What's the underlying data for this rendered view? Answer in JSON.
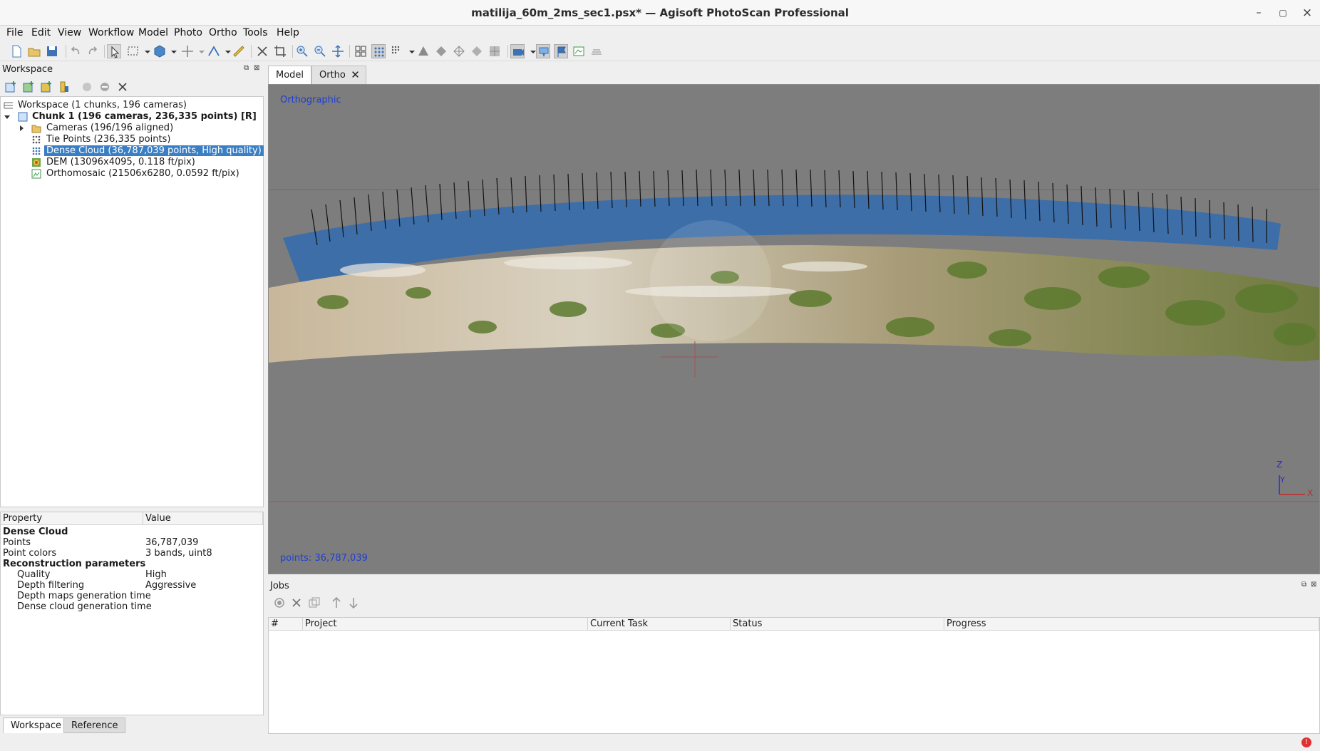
{
  "window": {
    "title": "matilija_60m_2ms_sec1.psx* — Agisoft PhotoScan Professional",
    "minimize": "–",
    "maximize": "▢",
    "close": "×"
  },
  "menu": [
    "File",
    "Edit",
    "View",
    "Workflow",
    "Model",
    "Photo",
    "Ortho",
    "Tools",
    "Help"
  ],
  "workspace": {
    "panel_title": "Workspace",
    "tree": {
      "root": "Workspace (1 chunks, 196 cameras)",
      "chunk": "Chunk 1 (196 cameras, 236,335 points) [R]",
      "cameras": "Cameras (196/196 aligned)",
      "tie_points": "Tie Points (236,335 points)",
      "dense_cloud": "Dense Cloud (36,787,039 points, High quality)",
      "dem": "DEM (13096x4095, 0.118 ft/pix)",
      "orthomosaic": "Orthomosaic (21506x6280, 0.0592 ft/pix)"
    }
  },
  "properties": {
    "header_property": "Property",
    "header_value": "Value",
    "rows": [
      {
        "key": "Dense Cloud",
        "value": "",
        "bold": true
      },
      {
        "key": "Points",
        "value": "36,787,039"
      },
      {
        "key": "Point colors",
        "value": "3 bands, uint8"
      },
      {
        "key": "Reconstruction parameters",
        "value": "",
        "bold": true
      },
      {
        "key": "Quality",
        "value": "High"
      },
      {
        "key": "Depth filtering",
        "value": "Aggressive"
      },
      {
        "key": "Depth maps generation time",
        "value": ""
      },
      {
        "key": "Dense cloud generation time",
        "value": ""
      }
    ]
  },
  "bottom_tabs": {
    "workspace": "Workspace",
    "reference": "Reference"
  },
  "view_tabs": {
    "model": "Model",
    "ortho": "Ortho"
  },
  "viewport": {
    "projection": "Orthographic",
    "points": "points: 36,787,039",
    "axis_z": "Z",
    "axis_y": "Y",
    "axis_x": "X"
  },
  "jobs": {
    "title": "Jobs",
    "columns": [
      "#",
      "Project",
      "Current Task",
      "Status",
      "Progress"
    ]
  },
  "colors": {
    "selection": "#3a7fc4",
    "viewport_bg": "#7d7d7d",
    "camera_band": "#3d6ea8",
    "label_blue": "#1f3fd1"
  }
}
